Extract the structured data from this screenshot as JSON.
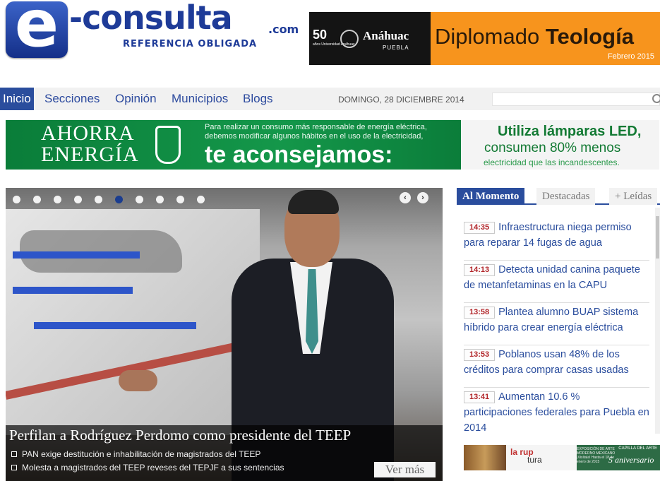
{
  "logo": {
    "letter": "e",
    "word": "-consulta",
    "domain": ".com",
    "tagline": "REFERENCIA OBLIGADA"
  },
  "ad_top": {
    "fifty": "50",
    "fifty_sub": "años Universidad Anáhuac",
    "brand": "Anáhuac",
    "city": "PUEBLA",
    "text_plain": "Diplomado ",
    "text_bold": "Teología",
    "date": "Febrero 2015",
    "bg": "#f7941d"
  },
  "nav": {
    "items": [
      {
        "label": "Inicio",
        "active": true
      },
      {
        "label": "Secciones"
      },
      {
        "label": "Opinión"
      },
      {
        "label": "Municipios"
      },
      {
        "label": "Blogs"
      }
    ],
    "date": "DOMINGO, 28 DICIEMBRE 2014",
    "search_placeholder": "",
    "accent": "#2a4d9d"
  },
  "banner": {
    "ahorra": "AHORRA",
    "energia": "ENERGÍA",
    "small": "Para realizar un consumo más responsable de energía eléctrica, debemos modificar algunos hábitos en el uso de la electricidad,",
    "big": "te aconsejamos:",
    "right1": "Utiliza lámparas LED,",
    "right2": "consumen 80% menos",
    "right3": "electricidad que las incandescentes."
  },
  "slider": {
    "dots": 10,
    "active_dot": 6,
    "title": "Perfilan a Rodríguez Perdomo como presidente del TEEP",
    "related": [
      "PAN exige destitución e inhabilitación de magistrados del TEEP",
      "Molesta a magistrados del TEEP reveses del TEPJF a sus sentencias"
    ],
    "more": "Ver más",
    "prev_icon": "chevron-left-icon",
    "next_icon": "chevron-right-icon"
  },
  "tabs": [
    {
      "label": "Al Momento",
      "active": true
    },
    {
      "label": "Destacadas"
    },
    {
      "label": "+ Leídas"
    }
  ],
  "news": [
    {
      "time": "14:35",
      "title": "Infraestructura niega permiso para reparar 14 fugas de agua"
    },
    {
      "time": "14:13",
      "title": "Detecta unidad canina paquete de metanfetaminas en la CAPU"
    },
    {
      "time": "13:58",
      "title": "Plantea alumno BUAP sistema híbrido para crear energía eléctrica"
    },
    {
      "time": "13:53",
      "title": "Poblanos usan 48% de los créditos para comprar casas usadas"
    },
    {
      "time": "13:41",
      "title": "Aumentan 10.6 % participaciones federales para Puebla en 2014"
    }
  ],
  "ad_side": {
    "rup": "la rup",
    "tura": "tura",
    "aniv": "5 aniversario",
    "capilla": "CAPILLA DEL ARTE",
    "small": "EXPOSICIÓN DE ARTE MODERNO MEXICANO ¡Visítala! Hasta el 18 de enero de 2015"
  }
}
